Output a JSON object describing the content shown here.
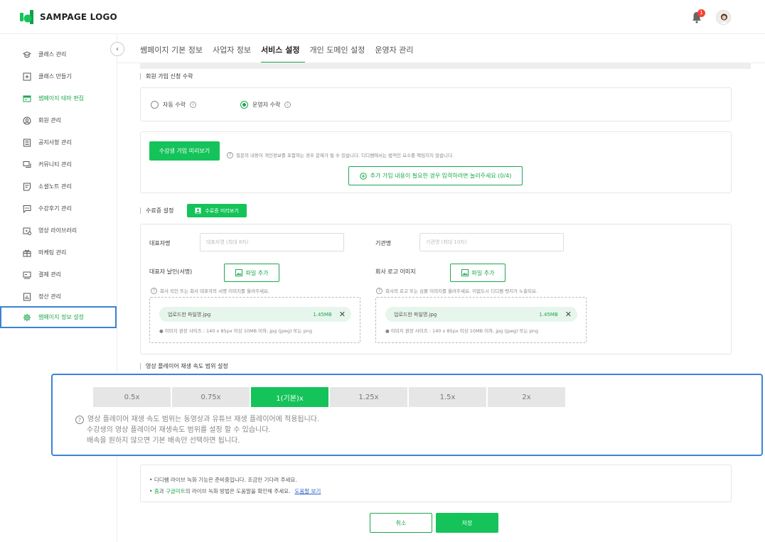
{
  "header": {
    "logo_text": "SAMPAGE LOGO",
    "notification_count": "1"
  },
  "sidebar": {
    "items": [
      {
        "label": "클래스 관리",
        "icon": "graduation-cap-icon"
      },
      {
        "label": "클래스 만들기",
        "icon": "add-square-icon"
      },
      {
        "label": "쌤페이지 테마 편집",
        "icon": "theme-window-icon"
      },
      {
        "label": "회원 관리",
        "icon": "user-circle-icon"
      },
      {
        "label": "공지사항 관리",
        "icon": "list-doc-icon"
      },
      {
        "label": "커뮤니티 관리",
        "icon": "chat-bubble-icon"
      },
      {
        "label": "소셜노트 관리",
        "icon": "note-icon"
      },
      {
        "label": "수강후기 관리",
        "icon": "comment-dots-icon"
      },
      {
        "label": "영상 라이브러리",
        "icon": "video-library-icon"
      },
      {
        "label": "마케팅 관리",
        "icon": "gift-icon"
      },
      {
        "label": "결제 관리",
        "icon": "payment-icon"
      },
      {
        "label": "정산 관리",
        "icon": "chart-doc-icon"
      },
      {
        "label": "쌤페이지 정보 설정",
        "icon": "gear-icon"
      }
    ]
  },
  "tabs": [
    "쌤페이지 기본 정보",
    "사업자 정보",
    "서비스 설정",
    "개인 도메인 설정",
    "운영자 관리"
  ],
  "signup": {
    "title": "회원 가입 신청 수락",
    "auto_label": "자동 수락",
    "operator_label": "운영자 수락",
    "preview_button": "수강생 가입 미리보기",
    "hint": "질문의 내용이 개인정보를 포함하는 경우 문제가 될 수 있습니다. 디디쌤에서는 법적인 요소를 책임지지 않습니다.",
    "add_button": "추가 가입 내용이 필요한 경우 입력하려면 눌러주세요 (0/4)"
  },
  "certificate": {
    "title": "수료증 설정",
    "preview_button": "수료증 미리보기",
    "rep_name_label": "대표자명",
    "rep_name_placeholder": "대표자명 (최대 8자)",
    "org_name_label": "기관명",
    "org_name_placeholder": "기관명 (최대 10자)",
    "seal_label": "대표자 날인(서명)",
    "logo_label": "회사 로고 이미지",
    "file_add": "파일 추가",
    "seal_hint": "회사 직인 또는 회사 대표자의 서명 이미지를 올려주세요.",
    "logo_hint": "회사의 로고 또는 심볼 이미지를 올려주세요. 이없도시 디디쌤 뱃지가 노출되요.",
    "file_name": "업로드한 파일명.jpg",
    "file_size": "1.45MB",
    "file_note": "● 이미지 권장 사이즈 : 140 x 85px 이상 10MB 이하, jpg (jpeg) 또는 png"
  },
  "speed": {
    "title": "영상 플레이어 재생 속도 범위 설정",
    "options": [
      "0.5x",
      "0.75x",
      "1(기본)x",
      "1.25x",
      "1.5x",
      "2x"
    ],
    "selected_index": 2,
    "notes": [
      "영상 플레이어 재생 속도 범위는 동영상과 유튜브 재생 플레이어에 적용됩니다.",
      "수강생의 영상 플레이어 재생속도 범위를 설정 할 수 있습니다.",
      "배속을 원하지 않으면 기본 배속만 선택하면 됩니다."
    ]
  },
  "notice": {
    "line1": "• 디디쌤 라이브 녹화 기능은 준비중입니다. 조금만 기다려 주세요.",
    "line2_prefix": "• ",
    "line2_zoom": "줌",
    "line2_mid1": "과 ",
    "line2_meet": "구글미트",
    "line2_suffix": "의 라이브 녹화 방법은 도움말을 확인해 주세요.",
    "help_link": "도움말 보기"
  },
  "footer": {
    "cancel": "취소",
    "save": "저장"
  },
  "colors": {
    "accent": "#14c35a",
    "selection_border": "#3b82d6"
  }
}
